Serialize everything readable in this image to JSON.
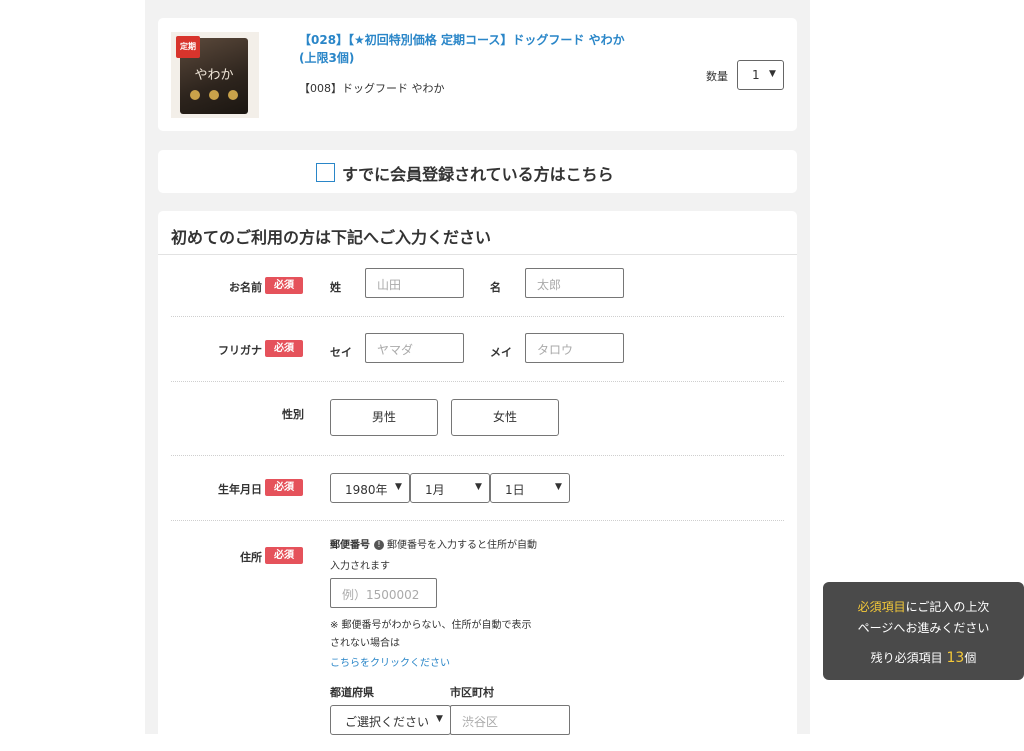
{
  "product": {
    "badge": "定期",
    "logo_text": "やわか",
    "title": "【028】【★初回特別価格 定期コース】ドッグフード やわか(上限3個)",
    "subtitle": "【008】ドッグフード やわか",
    "qty_label": "数量",
    "qty_value": "1"
  },
  "member": {
    "text": "すでに会員登録されている方はこちら"
  },
  "form": {
    "heading": "初めてのご利用の方は下記へご入力ください",
    "required_badge": "必須",
    "name": {
      "label": "お名前",
      "last_label": "姓",
      "last_placeholder": "山田",
      "first_label": "名",
      "first_placeholder": "太郎"
    },
    "kana": {
      "label": "フリガナ",
      "last_label": "セイ",
      "last_placeholder": "ヤマダ",
      "first_label": "メイ",
      "first_placeholder": "タロウ"
    },
    "gender": {
      "label": "性別",
      "male": "男性",
      "female": "女性"
    },
    "birth": {
      "label": "生年月日",
      "year": "1980年",
      "month": "1月",
      "day": "1日"
    },
    "address": {
      "label": "住所",
      "zip_label": "郵便番号",
      "zip_hint_line1": "郵便番号を入力すると住所が自動",
      "zip_hint_line2": "入力されます",
      "zip_placeholder": "例）1500002",
      "note_line1": "※ 郵便番号がわからない、住所が自動で表示",
      "note_line2": "されない場合は",
      "link": "こちらをクリックください",
      "pref_label": "都道府県",
      "city_label": "市区町村",
      "pref_value": "ご選択ください",
      "city_placeholder": "渋谷区"
    }
  },
  "toast": {
    "highlight": "必須項目",
    "line1_rest": "にご記入の上次",
    "line2": "ページへお進みください",
    "remaining_label": "残り必須項目",
    "remaining_count": "13",
    "remaining_unit": "個"
  },
  "colors": {
    "link_blue": "#2a86c8",
    "required_red": "#e5525b",
    "toast_bg": "#4a4a4a",
    "toast_highlight": "#f5c938"
  }
}
